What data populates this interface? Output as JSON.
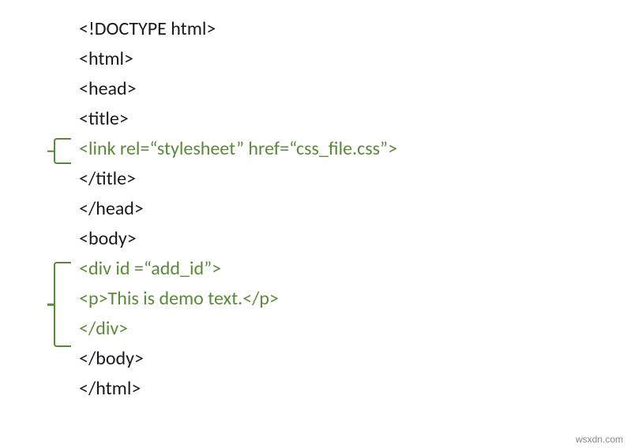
{
  "code": {
    "line1": "<!DOCTYPE html>",
    "line2": "<html>",
    "line3": "<head>",
    "line4": "<title>",
    "line5": "<link rel=“stylesheet” href=“css_file.css”>",
    "line6": "</title>",
    "line7": "</head>",
    "line8": "<body>",
    "line9": "<div id =“add_id”>",
    "line10": "<p>This is demo text.</p>",
    "line11": "</div>",
    "line12": "</body>",
    "line13": "</html>"
  },
  "watermark": "wsxdn.com"
}
